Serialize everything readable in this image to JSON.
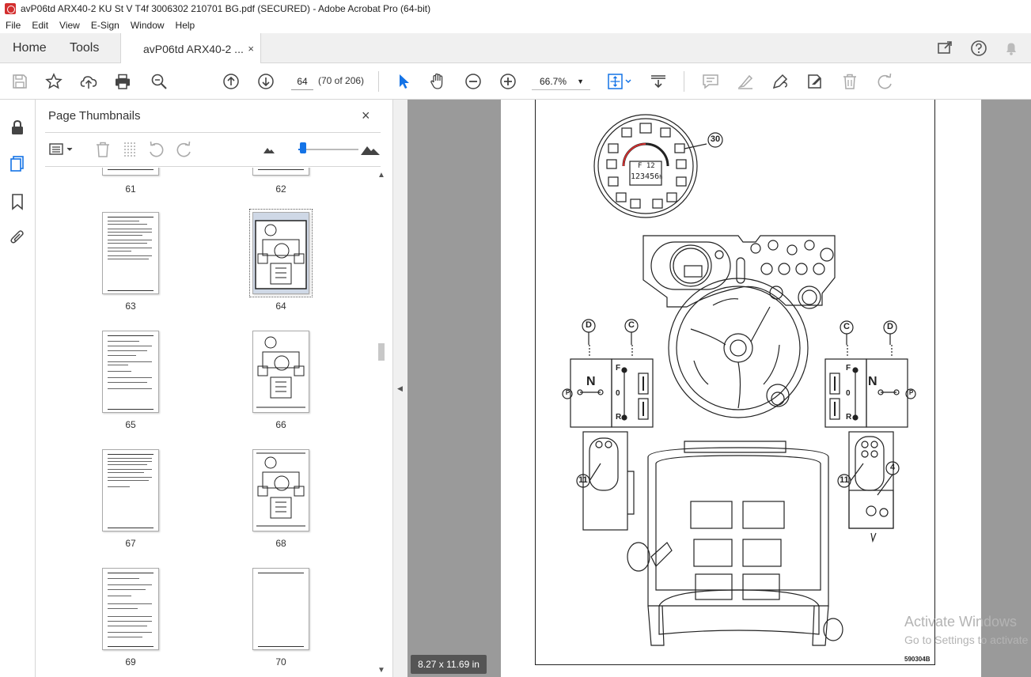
{
  "window": {
    "title": "avP06td ARX40-2 KU St V T4f 3006302 210701 BG.pdf (SECURED) - Adobe Acrobat Pro (64-bit)"
  },
  "menu": [
    "File",
    "Edit",
    "View",
    "E-Sign",
    "Window",
    "Help"
  ],
  "tabs": {
    "home": "Home",
    "tools": "Tools",
    "document": "avP06td ARX40-2 ...",
    "close": "×"
  },
  "toolbar": {
    "page_number": "64",
    "page_count": "(70 of 206)",
    "zoom": "66.7%",
    "zoom_caret": "▼",
    "icons": [
      "save-icon",
      "star-icon",
      "upload-icon",
      "print-icon",
      "search-zoom-icon",
      "page-up-icon",
      "page-down-icon",
      "select-cursor-icon",
      "hand-icon",
      "zoom-out-icon",
      "zoom-in-icon",
      "fit-page-icon",
      "scroll-mode-icon",
      "comment-icon",
      "highlight-icon",
      "sign-icon",
      "edit-pdf-icon",
      "delete-icon",
      "redo-icon"
    ]
  },
  "thumbnails_panel": {
    "title": "Page Thumbnails",
    "close": "×",
    "pages": [
      {
        "label": "61",
        "kind": "text"
      },
      {
        "label": "62",
        "kind": "figure"
      },
      {
        "label": "63",
        "kind": "text"
      },
      {
        "label": "64",
        "kind": "figure",
        "selected": true
      },
      {
        "label": "65",
        "kind": "text"
      },
      {
        "label": "66",
        "kind": "figure"
      },
      {
        "label": "67",
        "kind": "text"
      },
      {
        "label": "68",
        "kind": "figure"
      },
      {
        "label": "69",
        "kind": "text"
      },
      {
        "label": "70",
        "kind": "blank"
      }
    ]
  },
  "collapse_arrow": "◀",
  "document": {
    "page_size": "8.27 x 11.69 in",
    "figure_code": "590304B",
    "callouts": {
      "c30": "30",
      "c11a": "11",
      "c11b": "11",
      "c4": "4",
      "dL": "D",
      "cL": "C",
      "cR": "C",
      "dR": "D"
    },
    "lever_labels": {
      "n": "N",
      "f": "F",
      "zero": "0",
      "r": "R",
      "p": "P"
    },
    "display": {
      "gear": "F 12",
      "hours": "123456",
      "hours_unit": "h"
    }
  },
  "watermark": {
    "line1": "Activate Windows",
    "line2": "Go to Settings to activate Windows."
  },
  "colors": {
    "accent": "#1473e6",
    "pdf_red": "#d32f2f"
  }
}
